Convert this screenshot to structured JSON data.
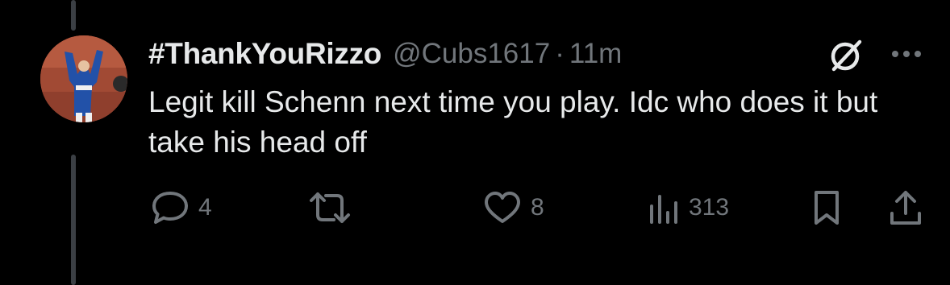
{
  "tweet": {
    "display_name": "#ThankYouRizzo",
    "handle": "@Cubs1617",
    "separator": "·",
    "time": "11m",
    "text": "Legit kill Schenn next time you play. Idc who does it but take his head off"
  },
  "actions": {
    "reply_count": "4",
    "like_count": "8",
    "view_count": "313"
  },
  "icons": {
    "reply": "reply-icon",
    "retweet": "retweet-icon",
    "like": "heart-icon",
    "views": "views-icon",
    "bookmark": "bookmark-icon",
    "share": "share-icon",
    "grok": "grok-icon",
    "more": "more-icon"
  },
  "colors": {
    "background": "#000000",
    "text": "#e7e9ea",
    "muted": "#71767b",
    "thread_line": "#3b3f44"
  }
}
